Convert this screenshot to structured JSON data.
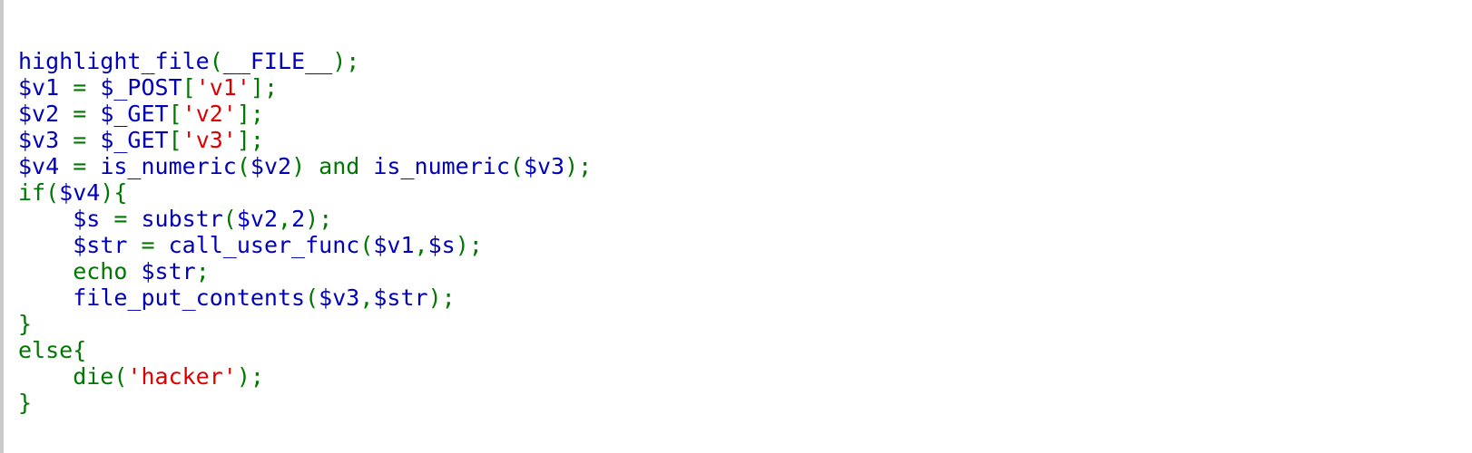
{
  "colors": {
    "default": "#0000BB",
    "keyword": "#007700",
    "string": "#DD0000",
    "background": "#FFFFFF"
  },
  "code": {
    "lines": [
      [
        {
          "t": "highlight_file",
          "c": "default"
        },
        {
          "t": "(",
          "c": "keyword"
        },
        {
          "t": "__FILE__",
          "c": "default"
        },
        {
          "t": ");",
          "c": "keyword"
        }
      ],
      [
        {
          "t": "$v1 ",
          "c": "default"
        },
        {
          "t": "= ",
          "c": "keyword"
        },
        {
          "t": "$_POST",
          "c": "default"
        },
        {
          "t": "[",
          "c": "keyword"
        },
        {
          "t": "'v1'",
          "c": "string"
        },
        {
          "t": "];",
          "c": "keyword"
        }
      ],
      [
        {
          "t": "$v2 ",
          "c": "default"
        },
        {
          "t": "= ",
          "c": "keyword"
        },
        {
          "t": "$_GET",
          "c": "default"
        },
        {
          "t": "[",
          "c": "keyword"
        },
        {
          "t": "'v2'",
          "c": "string"
        },
        {
          "t": "];",
          "c": "keyword"
        }
      ],
      [
        {
          "t": "$v3 ",
          "c": "default"
        },
        {
          "t": "= ",
          "c": "keyword"
        },
        {
          "t": "$_GET",
          "c": "default"
        },
        {
          "t": "[",
          "c": "keyword"
        },
        {
          "t": "'v3'",
          "c": "string"
        },
        {
          "t": "];",
          "c": "keyword"
        }
      ],
      [
        {
          "t": "$v4 ",
          "c": "default"
        },
        {
          "t": "= ",
          "c": "keyword"
        },
        {
          "t": "is_numeric",
          "c": "default"
        },
        {
          "t": "(",
          "c": "keyword"
        },
        {
          "t": "$v2",
          "c": "default"
        },
        {
          "t": ") and ",
          "c": "keyword"
        },
        {
          "t": "is_numeric",
          "c": "default"
        },
        {
          "t": "(",
          "c": "keyword"
        },
        {
          "t": "$v3",
          "c": "default"
        },
        {
          "t": ");",
          "c": "keyword"
        }
      ],
      [
        {
          "t": "if(",
          "c": "keyword"
        },
        {
          "t": "$v4",
          "c": "default"
        },
        {
          "t": "){",
          "c": "keyword"
        }
      ],
      [
        {
          "t": "    ",
          "c": "keyword"
        },
        {
          "t": "$s ",
          "c": "default"
        },
        {
          "t": "= ",
          "c": "keyword"
        },
        {
          "t": "substr",
          "c": "default"
        },
        {
          "t": "(",
          "c": "keyword"
        },
        {
          "t": "$v2",
          "c": "default"
        },
        {
          "t": ",",
          "c": "keyword"
        },
        {
          "t": "2",
          "c": "default"
        },
        {
          "t": ");",
          "c": "keyword"
        }
      ],
      [
        {
          "t": "    ",
          "c": "keyword"
        },
        {
          "t": "$str ",
          "c": "default"
        },
        {
          "t": "= ",
          "c": "keyword"
        },
        {
          "t": "call_user_func",
          "c": "default"
        },
        {
          "t": "(",
          "c": "keyword"
        },
        {
          "t": "$v1",
          "c": "default"
        },
        {
          "t": ",",
          "c": "keyword"
        },
        {
          "t": "$s",
          "c": "default"
        },
        {
          "t": ");",
          "c": "keyword"
        }
      ],
      [
        {
          "t": "    echo ",
          "c": "keyword"
        },
        {
          "t": "$str",
          "c": "default"
        },
        {
          "t": ";",
          "c": "keyword"
        }
      ],
      [
        {
          "t": "    ",
          "c": "keyword"
        },
        {
          "t": "file_put_contents",
          "c": "default"
        },
        {
          "t": "(",
          "c": "keyword"
        },
        {
          "t": "$v3",
          "c": "default"
        },
        {
          "t": ",",
          "c": "keyword"
        },
        {
          "t": "$str",
          "c": "default"
        },
        {
          "t": ");",
          "c": "keyword"
        }
      ],
      [
        {
          "t": "}",
          "c": "keyword"
        }
      ],
      [
        {
          "t": "else{",
          "c": "keyword"
        }
      ],
      [
        {
          "t": "    die(",
          "c": "keyword"
        },
        {
          "t": "'hacker'",
          "c": "string"
        },
        {
          "t": ");",
          "c": "keyword"
        }
      ],
      [
        {
          "t": "}",
          "c": "keyword"
        }
      ]
    ]
  }
}
